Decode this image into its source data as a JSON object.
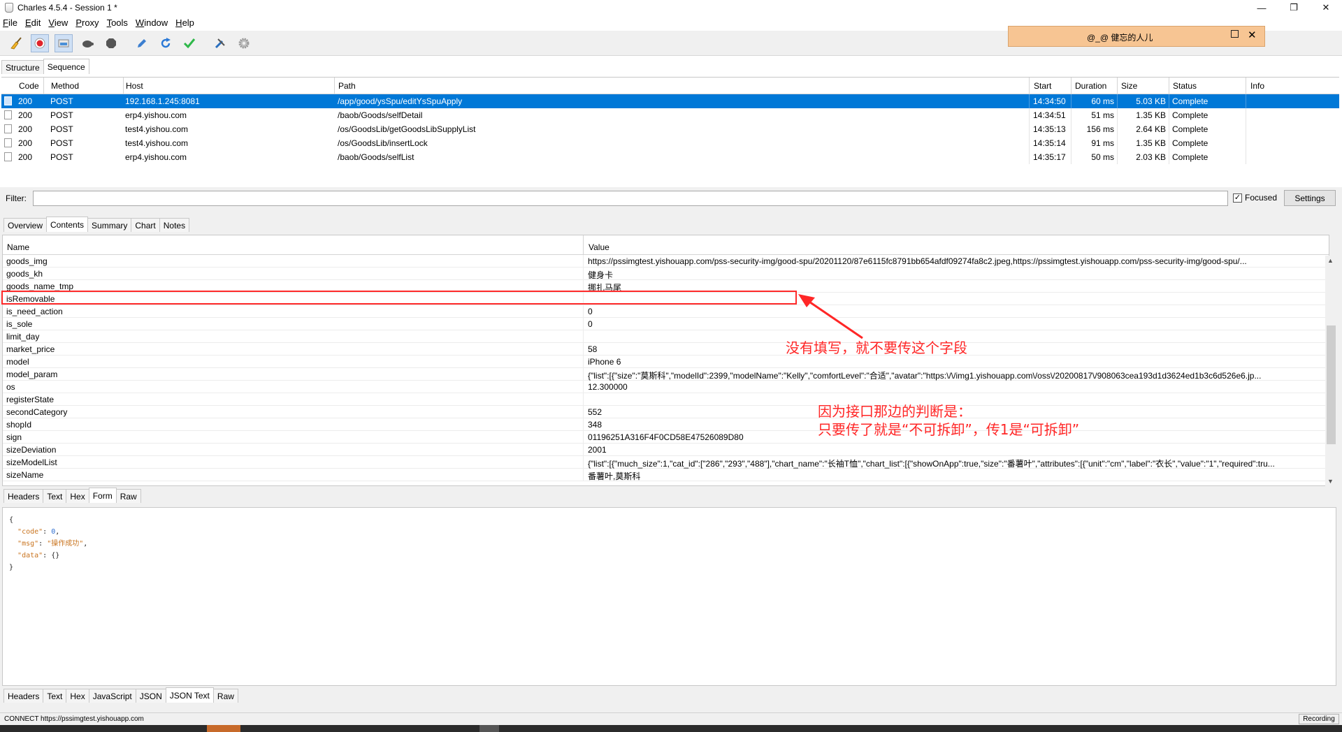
{
  "window": {
    "title": "Charles 4.5.4 - Session 1 *",
    "controls": {
      "minimize": "—",
      "restore": "❐",
      "close": "✕"
    }
  },
  "menu": [
    {
      "underline": "F",
      "rest": "ile"
    },
    {
      "underline": "E",
      "rest": "dit"
    },
    {
      "underline": "V",
      "rest": "iew"
    },
    {
      "underline": "P",
      "rest": "roxy"
    },
    {
      "underline": "T",
      "rest": "ools"
    },
    {
      "underline": "W",
      "rest": "indow"
    },
    {
      "underline": "H",
      "rest": "elp"
    }
  ],
  "toolbar": {
    "icons": [
      "broom-icon",
      "record-icon",
      "throttle-icon",
      "turtle-icon",
      "stop-icon",
      "pen-icon",
      "refresh-icon",
      "check-icon",
      "tools-icon",
      "gear-icon"
    ]
  },
  "float_widget": {
    "text": "@_@  健忘的人儿",
    "maximize": "",
    "close": "✕"
  },
  "top_tabs": [
    "Structure",
    "Sequence"
  ],
  "sequence": {
    "headers": [
      "Code",
      "Method",
      "Host",
      "Path",
      "Start",
      "Duration",
      "Size",
      "Status",
      "Info"
    ],
    "rows": [
      {
        "code": "200",
        "method": "POST",
        "host": "192.168.1.245:8081",
        "path": "/app/good/ysSpu/editYsSpuApply",
        "start": "14:34:50",
        "duration": "60 ms",
        "size": "5.03 KB",
        "status": "Complete",
        "info": ""
      },
      {
        "code": "200",
        "method": "POST",
        "host": "erp4.yishou.com",
        "path": "/baob/Goods/selfDetail",
        "start": "14:34:51",
        "duration": "51 ms",
        "size": "1.35 KB",
        "status": "Complete",
        "info": ""
      },
      {
        "code": "200",
        "method": "POST",
        "host": "test4.yishou.com",
        "path": "/os/GoodsLib/getGoodsLibSupplyList",
        "start": "14:35:13",
        "duration": "156 ms",
        "size": "2.64 KB",
        "status": "Complete",
        "info": ""
      },
      {
        "code": "200",
        "method": "POST",
        "host": "test4.yishou.com",
        "path": "/os/GoodsLib/insertLock",
        "start": "14:35:14",
        "duration": "91 ms",
        "size": "1.35 KB",
        "status": "Complete",
        "info": ""
      },
      {
        "code": "200",
        "method": "POST",
        "host": "erp4.yishou.com",
        "path": "/baob/Goods/selfList",
        "start": "14:35:17",
        "duration": "50 ms",
        "size": "2.03 KB",
        "status": "Complete",
        "info": ""
      }
    ]
  },
  "filter": {
    "label": "Filter:",
    "value": "",
    "focused_check": "✓",
    "focused_label": "Focused",
    "settings_label": "Settings"
  },
  "detail_tabs": [
    "Overview",
    "Contents",
    "Summary",
    "Chart",
    "Notes"
  ],
  "contents": {
    "headers": {
      "name": "Name",
      "value": "Value"
    },
    "rows": [
      {
        "name": "goods_img",
        "value": "https://pssimgtest.yishouapp.com/pss-security-img/good-spu/20201120/87e6115fc8791bb654afdf09274fa8c2.jpeg,https://pssimgtest.yishouapp.com/pss-security-img/good-spu/..."
      },
      {
        "name": "goods_kh",
        "value": "健身卡"
      },
      {
        "name": "goods_name_tmp",
        "value": "挪扎马尾"
      },
      {
        "name": "isRemovable",
        "value": ""
      },
      {
        "name": "is_need_action",
        "value": "0"
      },
      {
        "name": "is_sole",
        "value": "0"
      },
      {
        "name": "limit_day",
        "value": ""
      },
      {
        "name": "market_price",
        "value": "58"
      },
      {
        "name": "model",
        "value": "iPhone 6"
      },
      {
        "name": "model_param",
        "value": "{\"list\":[{\"size\":\"莫斯科\",\"modelId\":2399,\"modelName\":\"Kelly\",\"comfortLevel\":\"合适\",\"avatar\":\"https:\\/\\/img1.yishouapp.com\\/oss\\/20200817\\/908063cea193d1d3624ed1b3c6d526e6.jp..."
      },
      {
        "name": "os",
        "value": "12.300000"
      },
      {
        "name": "registerState",
        "value": ""
      },
      {
        "name": "secondCategory",
        "value": "552"
      },
      {
        "name": "shopId",
        "value": "348"
      },
      {
        "name": "sign",
        "value": "01196251A316F4F0CD58E47526089D80"
      },
      {
        "name": "sizeDeviation",
        "value": "2001"
      },
      {
        "name": "sizeModelList",
        "value": "{\"list\":[{\"much_size\":1,\"cat_id\":[\"286\",\"293\",\"488\"],\"chart_name\":\"长袖T恤\",\"chart_list\":[{\"showOnApp\":true,\"size\":\"番薯叶\",\"attributes\":[{\"unit\":\"cm\",\"label\":\"衣长\",\"value\":\"1\",\"required\":tru..."
      },
      {
        "name": "sizeName",
        "value": "番薯叶,莫斯科"
      }
    ]
  },
  "request_tabs": [
    "Headers",
    "Text",
    "Hex",
    "Form",
    "Raw"
  ],
  "response_json": {
    "open": "{",
    "code_key": "\"code\"",
    "code_val": "0",
    "msg_key": "\"msg\"",
    "msg_val": "\"操作成功\"",
    "data_key": "\"data\"",
    "data_val": "{}",
    "close": "}"
  },
  "response_tabs": [
    "Headers",
    "Text",
    "Hex",
    "JavaScript",
    "JSON",
    "JSON Text",
    "Raw"
  ],
  "status_bar": {
    "text": "CONNECT https://pssimgtest.yishouapp.com",
    "recording": "Recording"
  },
  "annotation": {
    "note1": "没有填写，就不要传这个字段",
    "note2_line1": "因为接口那边的判断是：",
    "note2_line2": "只要传了就是“不可拆卸”，传1是“可拆卸”",
    "color": "#ff2626"
  }
}
